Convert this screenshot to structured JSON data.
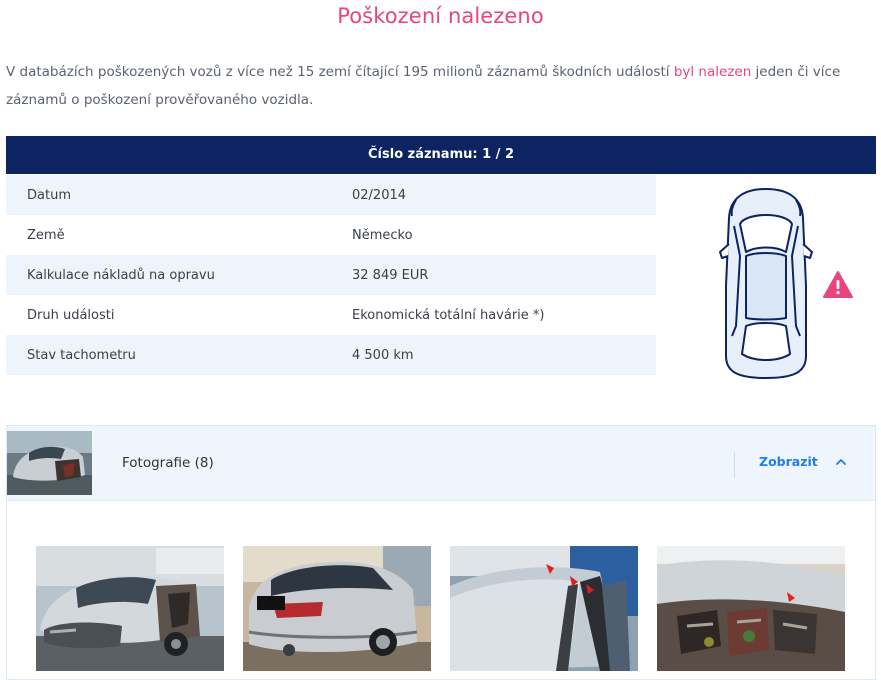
{
  "page": {
    "title": "Poškození nalezeno",
    "intro": {
      "before": "V databázích poškozených vozů z více než 15 zemí čítající 195 milionů záznamů škodních událostí ",
      "highlight": "byl nalezen",
      "after": " jeden či více záznamů o poškození prověřovaného vozidla."
    }
  },
  "record": {
    "header": "Číslo záznamu: 1 / 2",
    "rows": [
      {
        "label": "Datum",
        "value": "02/2014"
      },
      {
        "label": "Země",
        "value": "Německo"
      },
      {
        "label": "Kalkulace nákladů na opravu",
        "value": "32 849 EUR"
      },
      {
        "label": "Druh události",
        "value": "Ekonomická totální havárie *)"
      },
      {
        "label": "Stav tachometru",
        "value": "4 500 km"
      }
    ]
  },
  "photos": {
    "label": "Fotografie (8)",
    "show_label": "Zobrazit"
  },
  "colors": {
    "accent_pink": "#e8457a",
    "header_navy": "#0c2461",
    "link_blue": "#1f7ee8",
    "warning_red": "#e8457a"
  },
  "icons": {
    "car": "car-top-view-icon",
    "warning": "warning-triangle-icon",
    "chevron": "chevron-up-icon"
  }
}
